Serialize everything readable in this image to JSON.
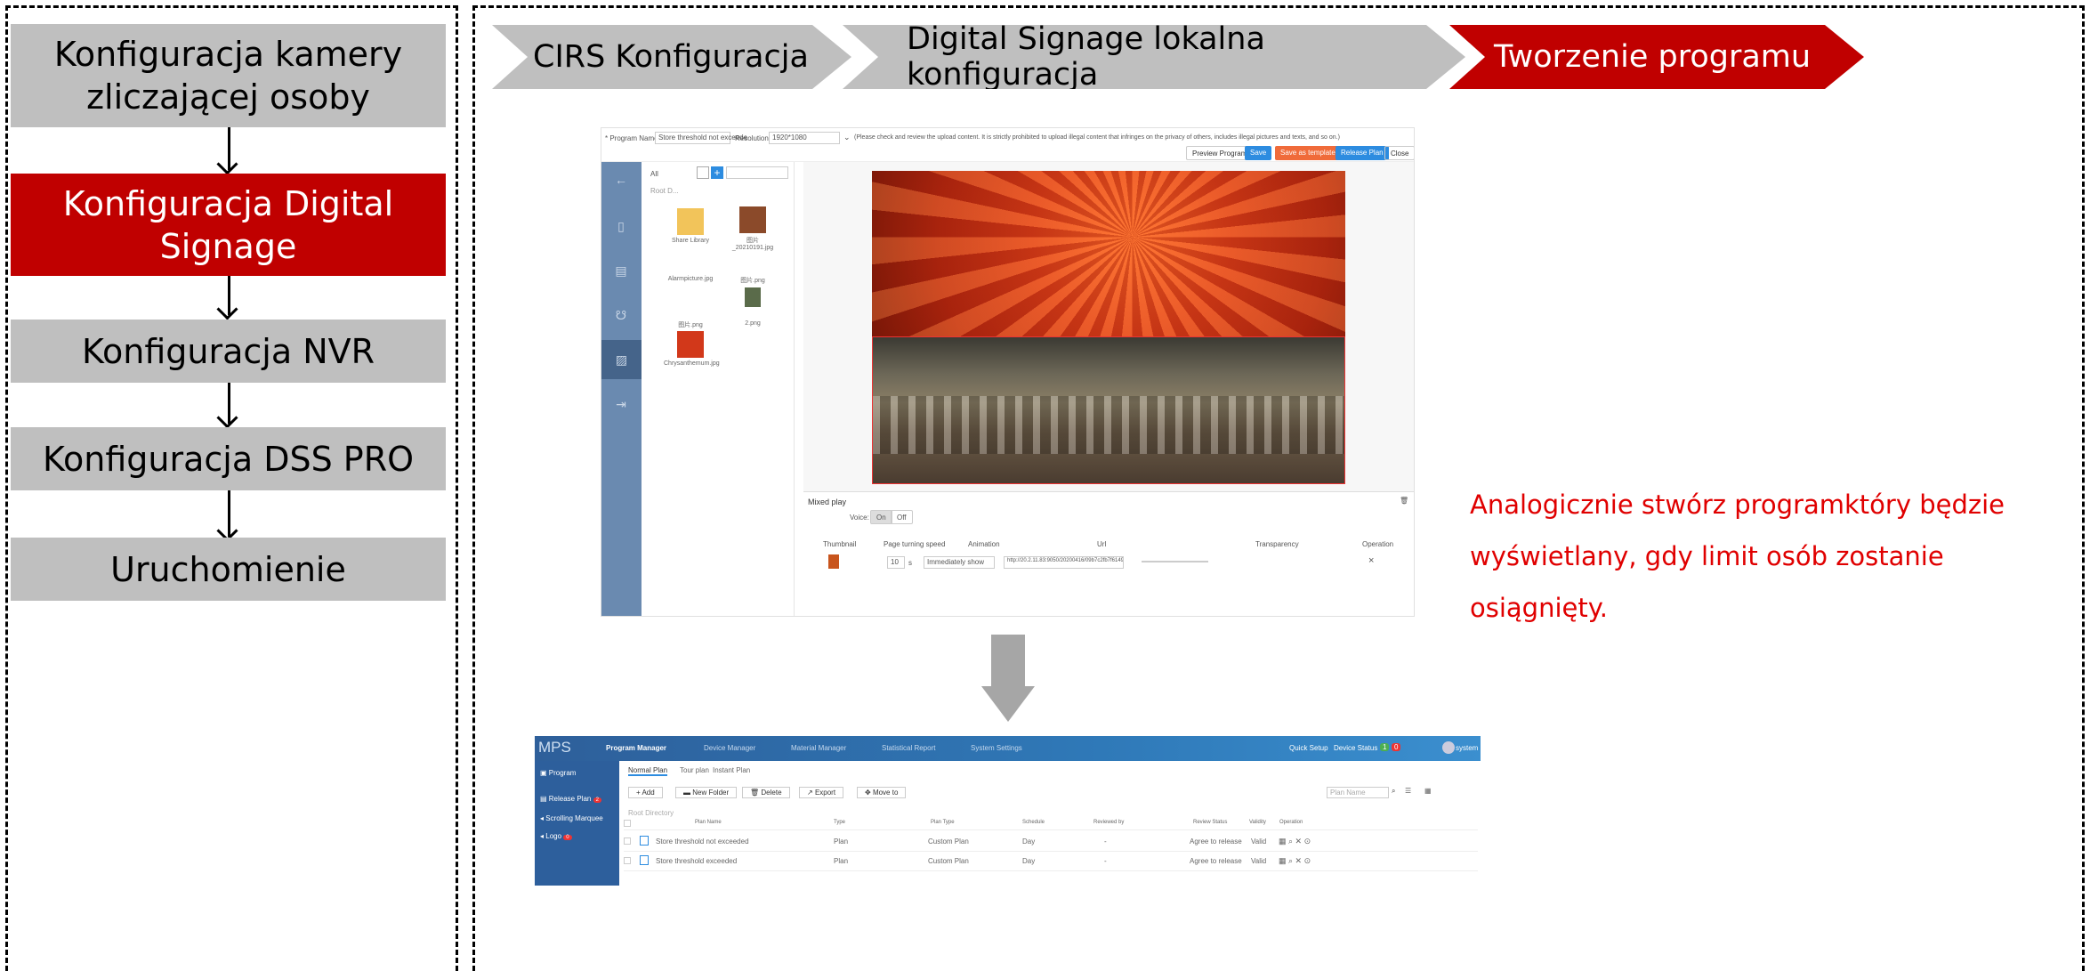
{
  "steps": [
    {
      "label": "Konfiguracja kamery zliczającej osoby",
      "active": false
    },
    {
      "label": "Konfiguracja Digital Signage",
      "active": true
    },
    {
      "label": "Konfiguracja NVR",
      "active": false
    },
    {
      "label": "Konfiguracja DSS PRO",
      "active": false
    },
    {
      "label": "Uruchomienie",
      "active": false
    }
  ],
  "breadcrumb": [
    "CIRS Konfiguracja",
    "Digital Signage lokalna konfiguracja",
    "Tworzenie programu"
  ],
  "description": "Analogicznie stwórz programktóry będzie wyświetlany, gdy limit osób zostanie osiągnięty.",
  "editor": {
    "program_name_label": "* Program Name:",
    "program_name_value": "Store threshold not exceede",
    "resolution_label": "Resolution:",
    "resolution_value": "1920*1080",
    "notice": "(Please check and review the upload content. It is strictly prohibited to upload illegal content that infringes on the privacy of others, includes illegal pictures and texts, and so on.)",
    "buttons": {
      "preview": "Preview Program",
      "save": "Save",
      "save_template": "Save as template",
      "release": "Release Plan",
      "close": "Close"
    },
    "library": {
      "filter": "All",
      "root": "Root D...",
      "items": [
        "Share Library",
        "图片_20210191.jpg",
        "Alarmpicture.jpg",
        "图片.png",
        "图片.png",
        "2.png",
        "Chrysanthemum.jpg"
      ]
    },
    "mixed_play": {
      "title": "Mixed play",
      "voice_label": "Voice:",
      "voice_on": "On",
      "voice_off": "Off",
      "columns": [
        "Thumbnail",
        "Page turning speed",
        "Animation",
        "Url",
        "Transparency",
        "Operation"
      ],
      "row": {
        "speed": "10",
        "unit": "s",
        "animation": "Immediately show",
        "url": "http://20.2.11.83:9050/20200416/09b7c2fb7f61496aa1723"
      }
    }
  },
  "mps": {
    "logo": "MPS",
    "nav": [
      "Program Manager",
      "Device Manager",
      "Material Manager",
      "Statistical Report",
      "System Settings"
    ],
    "quick_setup": "Quick Setup",
    "device_status": "Device Status",
    "status_counts": [
      "1",
      "0"
    ],
    "user": "system",
    "side": [
      {
        "label": "Program",
        "badge": ""
      },
      {
        "label": "Release Plan",
        "badge": "2"
      },
      {
        "label": "Scrolling Marquee",
        "badge": ""
      },
      {
        "label": "Logo",
        "badge": "0"
      }
    ],
    "tabs": [
      "Normal Plan",
      "Tour plan",
      "Instant Plan"
    ],
    "toolbar": [
      "Add",
      "New Folder",
      "Delete",
      "Export",
      "Move to"
    ],
    "search_placeholder": "Plan Name",
    "root_directory": "Root Directory",
    "columns": [
      "Plan Name",
      "Type",
      "Plan Type",
      "Schedule",
      "Reviewed by",
      "Review Status",
      "Validity",
      "Operation"
    ],
    "rows": [
      {
        "name": "Store threshold not exceeded",
        "type": "Plan",
        "plan_type": "Custom Plan",
        "schedule": "Day",
        "reviewed_by": "-",
        "status": "Agree to release",
        "validity": "Valid"
      },
      {
        "name": "Store threshold exceeded",
        "type": "Plan",
        "plan_type": "Custom Plan",
        "schedule": "Day",
        "reviewed_by": "-",
        "status": "Agree to release",
        "validity": "Valid"
      }
    ]
  },
  "colors": {
    "active": "#c00000",
    "inactive": "#bfbfbf",
    "description": "#e00000",
    "mps_blue": "#2f79b8"
  }
}
